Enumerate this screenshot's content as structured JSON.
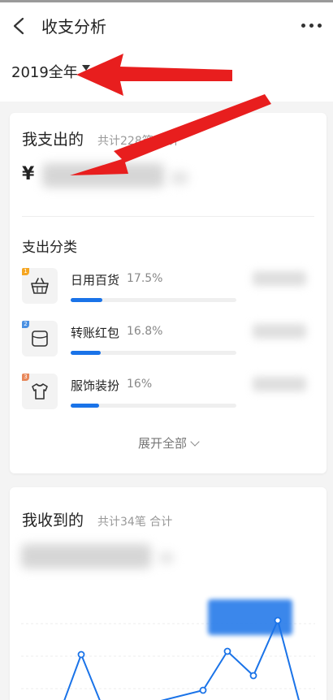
{
  "nav": {
    "title": "收支分析",
    "back_icon": "chevron-left-icon",
    "more_icon": "more-dots-icon"
  },
  "year_filter": {
    "label": "2019全年"
  },
  "expense": {
    "title": "我支出的",
    "summary": "共计228笔 合计",
    "currency": "¥",
    "category_title": "支出分类",
    "categories": [
      {
        "name": "日用百货",
        "percent": "17.5%",
        "fraction": 0.175,
        "icon": "basket-icon",
        "rank": "1",
        "rank_color": "#f5a623"
      },
      {
        "name": "转账红包",
        "percent": "16.8%",
        "fraction": 0.168,
        "icon": "wallet-icon",
        "rank": "2",
        "rank_color": "#4a90e2"
      },
      {
        "name": "服饰装扮",
        "percent": "16%",
        "fraction": 0.16,
        "icon": "shirt-icon",
        "rank": "3",
        "rank_color": "#e8875a"
      }
    ],
    "expand_label": "展开全部"
  },
  "income": {
    "title": "我收到的",
    "summary": "共计34笔 合计"
  },
  "colors": {
    "accent": "#1a73e8",
    "annotation_arrow": "#e81e1e"
  }
}
